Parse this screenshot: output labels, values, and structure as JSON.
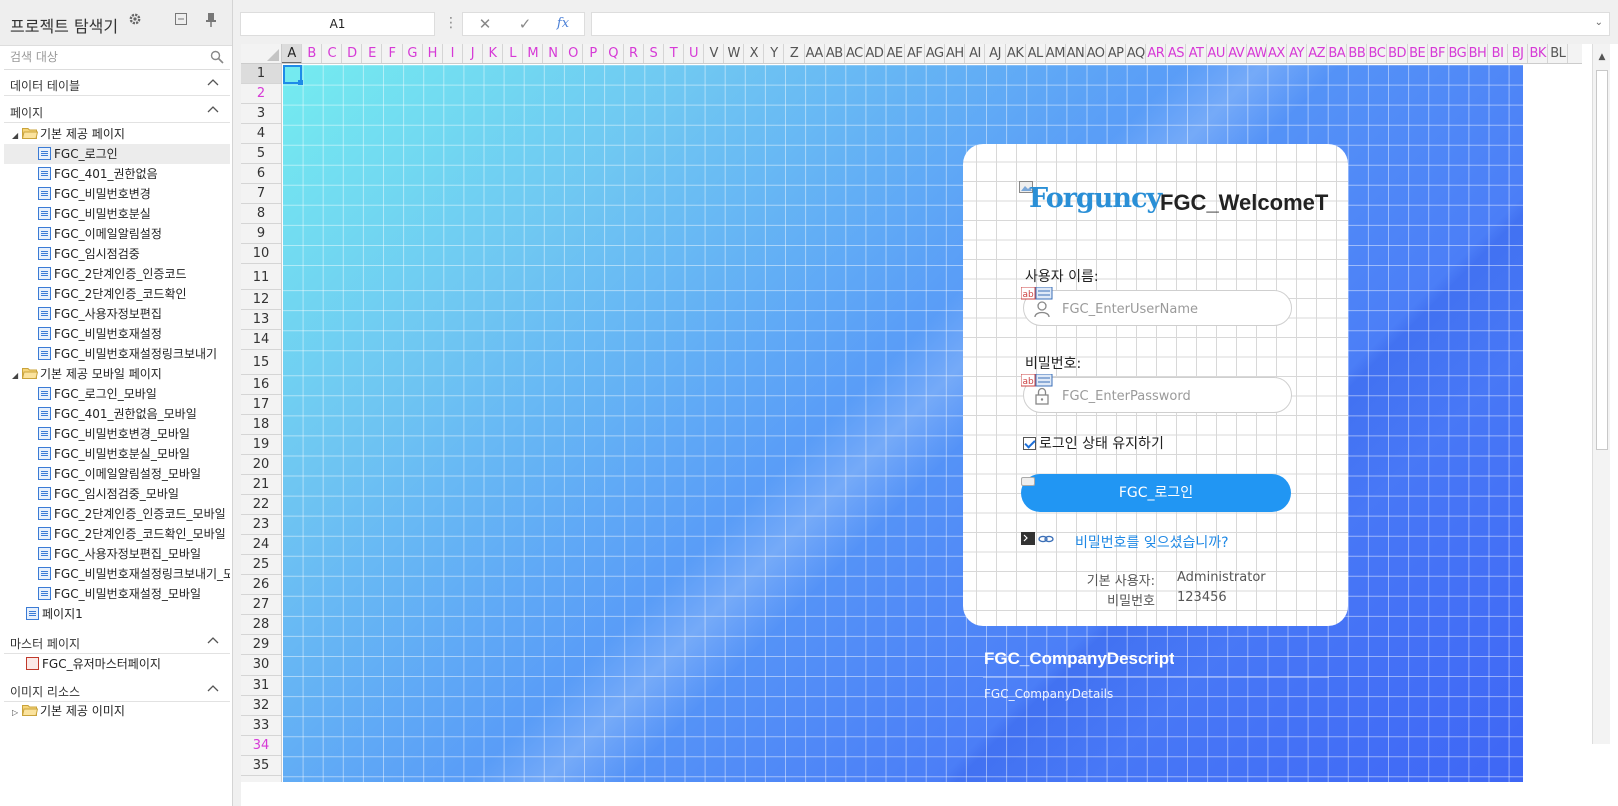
{
  "explorer": {
    "title": "프로젝트 탐색기",
    "search_placeholder": "검색 대상",
    "sections": {
      "data_tables": "데이터 테이블",
      "pages": "페이지",
      "master_pages": "마스터 페이지",
      "image_resources": "이미지 리소스"
    },
    "tree": [
      {
        "label": "기본 제공 페이지",
        "kind": "folder",
        "level": 0,
        "expanded": true
      },
      {
        "label": "FGC_로그인",
        "kind": "page",
        "level": 1,
        "selected": true
      },
      {
        "label": "FGC_401_권한없음",
        "kind": "page",
        "level": 1
      },
      {
        "label": "FGC_비밀번호변경",
        "kind": "page",
        "level": 1
      },
      {
        "label": "FGC_비밀번호분실",
        "kind": "page",
        "level": 1
      },
      {
        "label": "FGC_이메일알림설정",
        "kind": "page",
        "level": 1
      },
      {
        "label": "FGC_임시점검중",
        "kind": "page",
        "level": 1
      },
      {
        "label": "FGC_2단계인증_인증코드",
        "kind": "page",
        "level": 1
      },
      {
        "label": "FGC_2단계인증_코드확인",
        "kind": "page",
        "level": 1
      },
      {
        "label": "FGC_사용자정보편집",
        "kind": "page",
        "level": 1
      },
      {
        "label": "FGC_비밀번호재설정",
        "kind": "page",
        "level": 1
      },
      {
        "label": "FGC_비밀번호재설정링크보내기",
        "kind": "page",
        "level": 1
      },
      {
        "label": "기본 제공 모바일 페이지",
        "kind": "folder",
        "level": 0,
        "expanded": true
      },
      {
        "label": "FGC_로그인_모바일",
        "kind": "page",
        "level": 1
      },
      {
        "label": "FGC_401_권한없음_모바일",
        "kind": "page",
        "level": 1
      },
      {
        "label": "FGC_비밀번호변경_모바일",
        "kind": "page",
        "level": 1
      },
      {
        "label": "FGC_비밀번호분실_모바일",
        "kind": "page",
        "level": 1
      },
      {
        "label": "FGC_이메일알림설정_모바일",
        "kind": "page",
        "level": 1
      },
      {
        "label": "FGC_임시점검중_모바일",
        "kind": "page",
        "level": 1
      },
      {
        "label": "FGC_2단계인증_인증코드_모바일",
        "kind": "page",
        "level": 1
      },
      {
        "label": "FGC_2단계인증_코드확인_모바일",
        "kind": "page",
        "level": 1
      },
      {
        "label": "FGC_사용자정보편집_모바일",
        "kind": "page",
        "level": 1
      },
      {
        "label": "FGC_비밀번호재설정링크보내기_모",
        "kind": "page",
        "level": 1
      },
      {
        "label": "FGC_비밀번호재설정_모바일",
        "kind": "page",
        "level": 1
      },
      {
        "label": "페이지1",
        "kind": "page",
        "level": 0
      }
    ],
    "master_tree": [
      {
        "label": "FGC_유저마스터페이지",
        "kind": "master",
        "level": 0
      }
    ],
    "image_tree": [
      {
        "label": "기본 제공 이미지",
        "kind": "folder",
        "level": 0,
        "expanded": false
      }
    ]
  },
  "formula_bar": {
    "cell_ref": "A1",
    "separator": "⋮",
    "cancel": "✕",
    "confirm": "✓",
    "fx": "fx",
    "formula": "",
    "expand": "⌄"
  },
  "grid": {
    "columns": [
      "A",
      "B",
      "C",
      "D",
      "E",
      "F",
      "G",
      "H",
      "I",
      "J",
      "K",
      "L",
      "M",
      "N",
      "O",
      "P",
      "Q",
      "R",
      "S",
      "T",
      "U",
      "V",
      "W",
      "X",
      "Y",
      "Z",
      "AA",
      "AB",
      "AC",
      "AD",
      "AE",
      "AF",
      "AG",
      "AH",
      "AI",
      "AJ",
      "AK",
      "AL",
      "AM",
      "AN",
      "AO",
      "AP",
      "AQ",
      "AR",
      "AS",
      "AT",
      "AU",
      "AV",
      "AW",
      "AX",
      "AY",
      "AZ",
      "BA",
      "BB",
      "BC",
      "BD",
      "BE",
      "BF",
      "BG",
      "BH",
      "BI",
      "BJ",
      "BK",
      "BL"
    ],
    "magenta_columns": [
      "B",
      "C",
      "D",
      "E",
      "F",
      "G",
      "H",
      "I",
      "J",
      "K",
      "L",
      "M",
      "N",
      "O",
      "P",
      "Q",
      "R",
      "S",
      "T",
      "U",
      "AR",
      "AS",
      "AT",
      "AU",
      "AV",
      "AW",
      "AX",
      "AY",
      "AZ",
      "BA",
      "BB",
      "BC",
      "BD",
      "BE",
      "BF",
      "BG",
      "BH",
      "BI",
      "BJ",
      "BK"
    ],
    "rows": [
      "1",
      "2",
      "3",
      "4",
      "5",
      "6",
      "7",
      "8",
      "9",
      "10",
      "11",
      "12",
      "13",
      "14",
      "15",
      "16",
      "17",
      "18",
      "19",
      "20",
      "21",
      "22",
      "23",
      "24",
      "25",
      "26",
      "27",
      "28",
      "29",
      "30",
      "31",
      "32",
      "33",
      "34",
      "35"
    ],
    "magenta_rows": [
      "2",
      "34"
    ],
    "active_cell": "A1"
  },
  "login": {
    "logo_text": "Forguncy",
    "welcome": "FGC_WelcomeT",
    "username_label": "사용자 이름:",
    "username_placeholder": "FGC_EnterUserName",
    "password_label": "비밀번호:",
    "password_placeholder": "FGC_EnterPassword",
    "remember": "로그인 상태 유지하기",
    "login_button": "FGC_로그인",
    "forgot_link": "비밀번호를 잊으셨습니까?",
    "default_user_label": "기본 사용자:",
    "default_user_value": "Administrator",
    "default_pw_label": "비밀번호",
    "default_pw_value": "123456"
  },
  "company": {
    "title": "FGC_CompanyDescript",
    "details": "FGC_CompanyDetails"
  },
  "colors": {
    "accent": "#2196f3",
    "link": "#1e88e5",
    "header_magenta": "#d63ad6"
  }
}
